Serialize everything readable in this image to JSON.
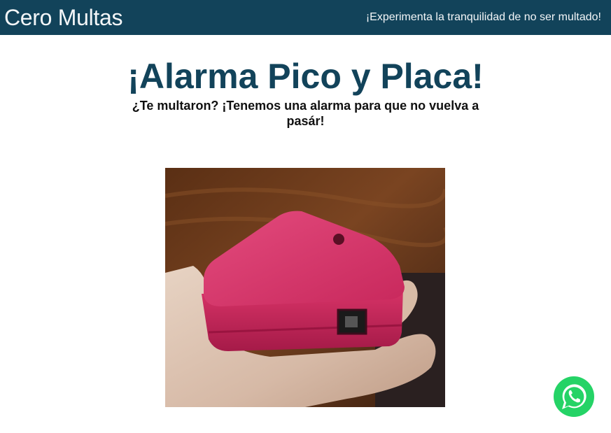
{
  "header": {
    "brand": "Cero Multas",
    "tagline": "¡Experimenta la tranquilidad de no ser multado!",
    "background_color": "#12435a"
  },
  "hero": {
    "title": "¡Alarma Pico y Placa!",
    "subtitle": "¿Te multaron? ¡Tenemos una alarma para que no vuelva a pasár!",
    "title_color": "#12435a"
  },
  "product_image": {
    "subject": "pink 3D-printed alarm box held in hand"
  },
  "floating_action": {
    "icon": "whatsapp-icon",
    "color": "#25d366"
  }
}
